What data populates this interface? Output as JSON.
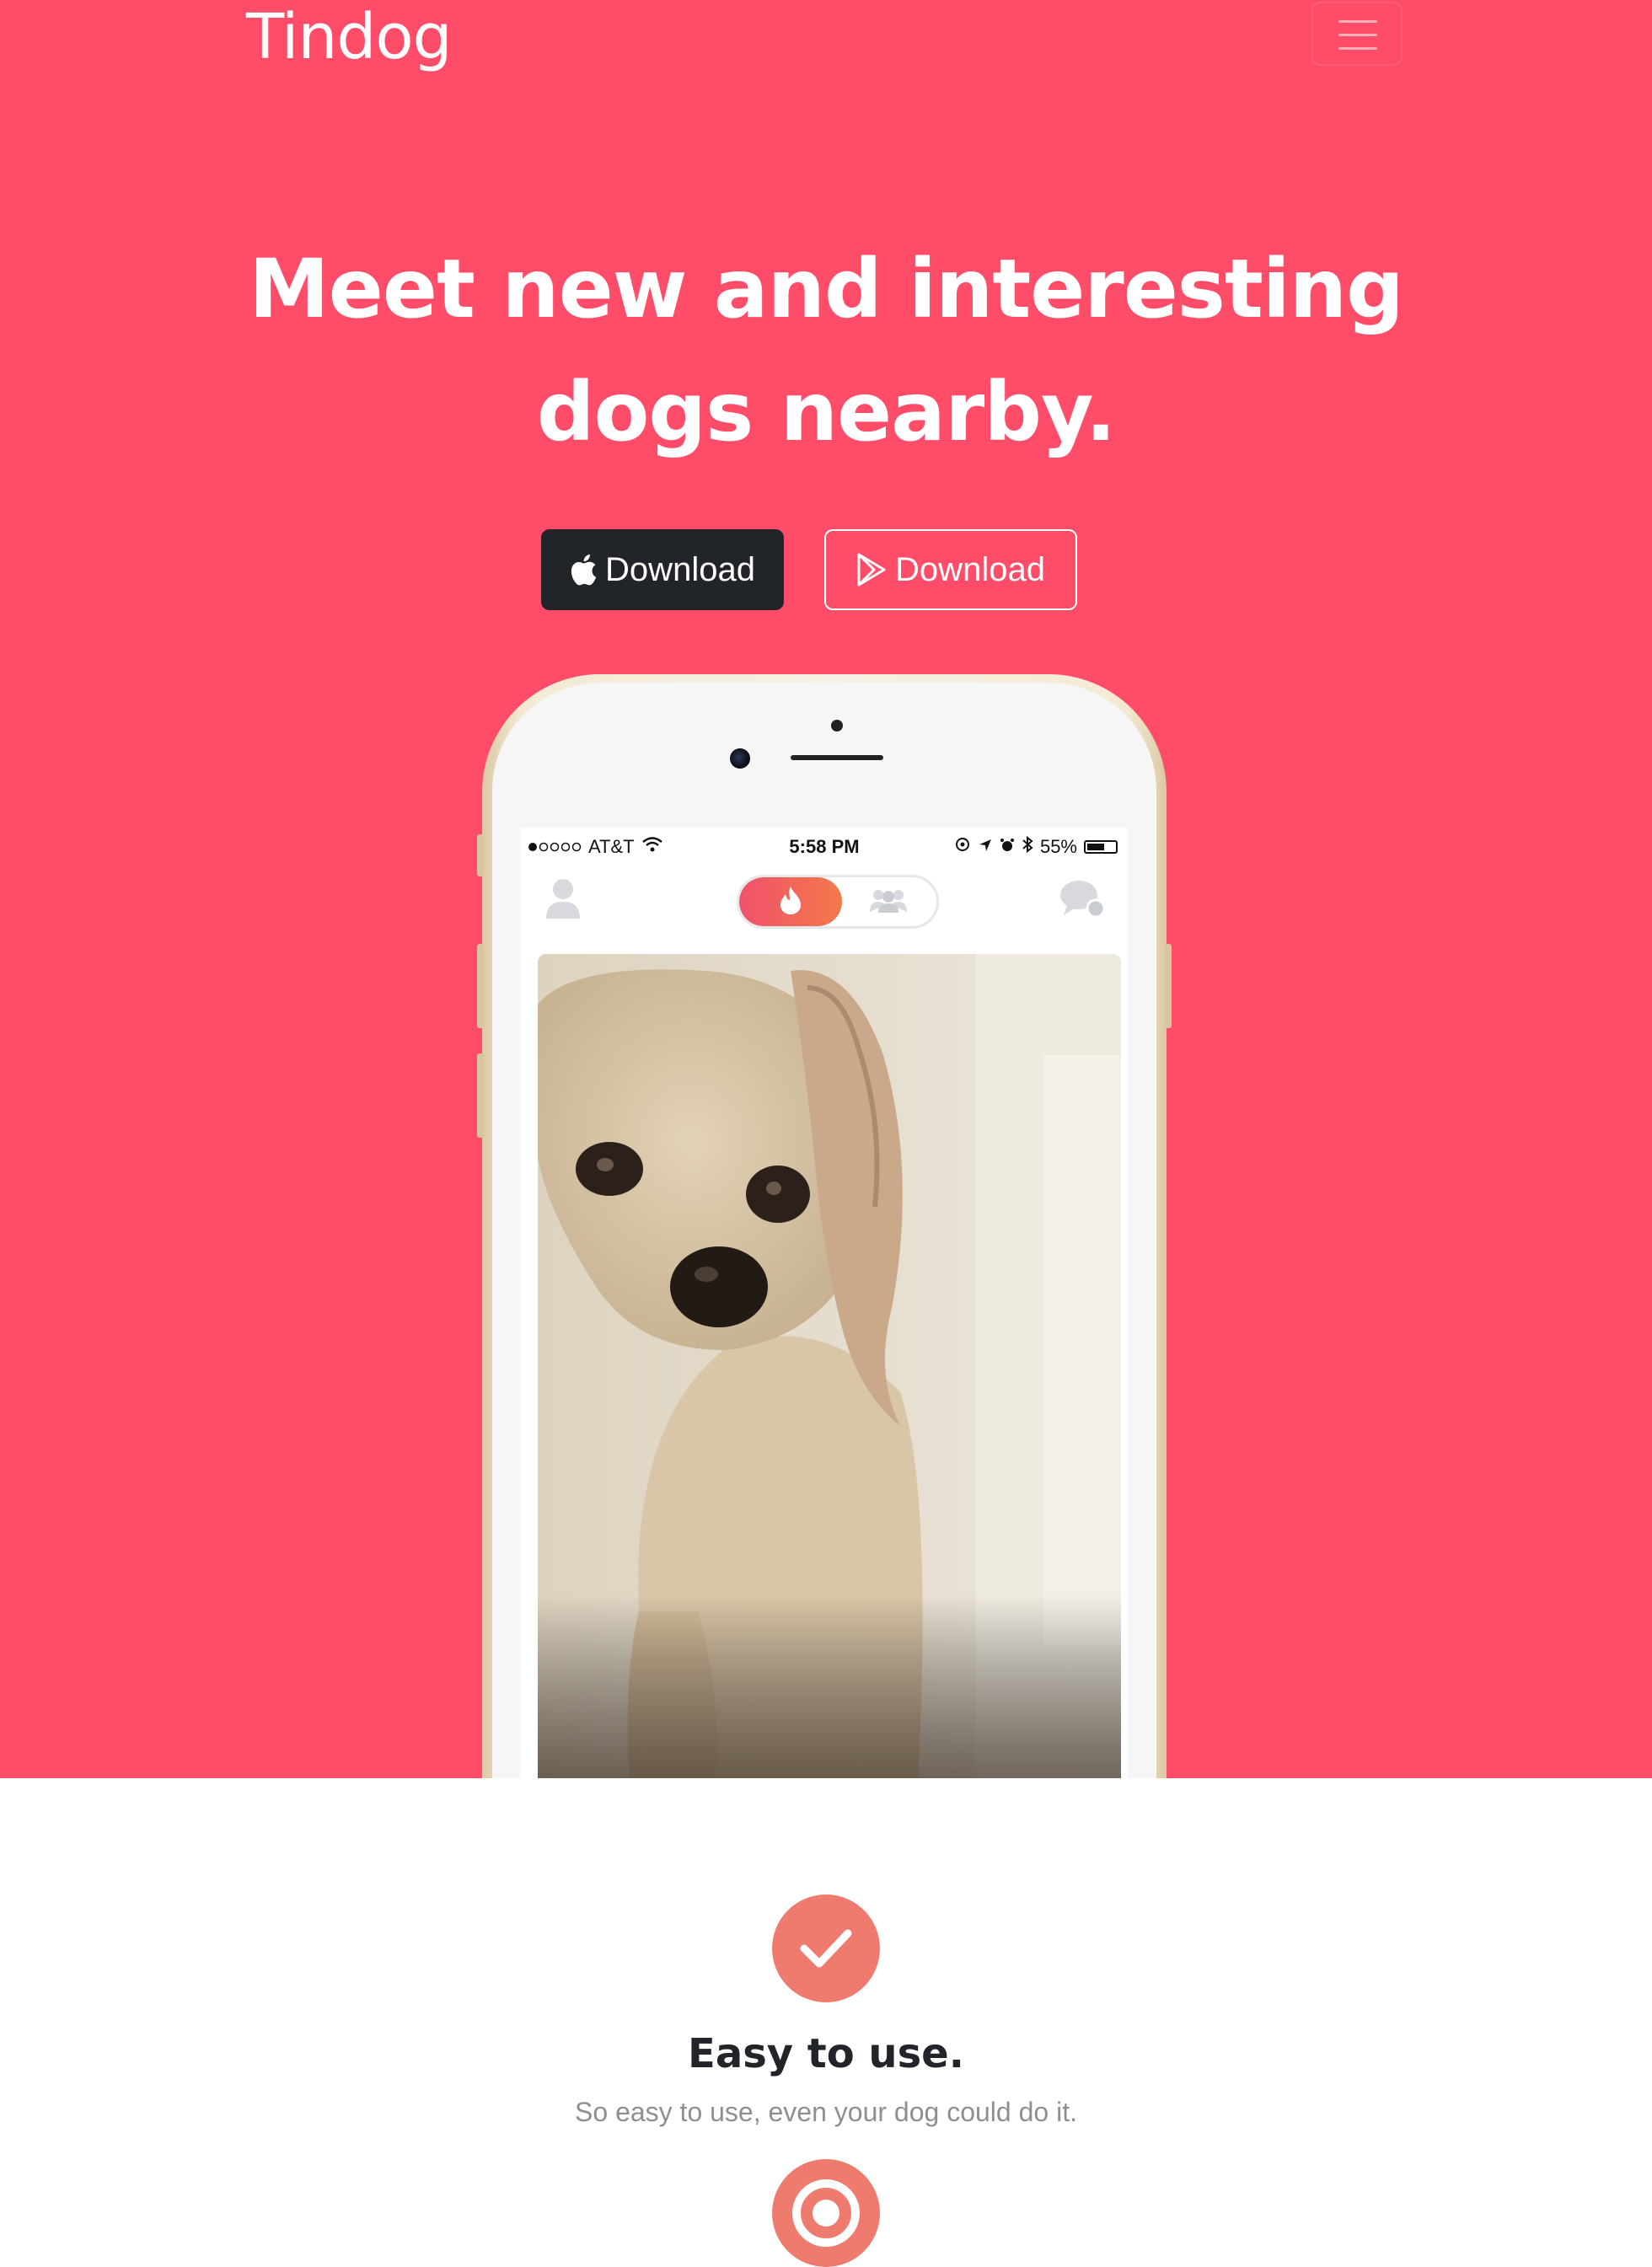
{
  "navbar": {
    "brand": "Tindog"
  },
  "hero": {
    "title_line1": "Meet new and interesting",
    "title_line2": "dogs nearby.",
    "buttons": [
      {
        "label": "Download",
        "icon": "apple-icon"
      },
      {
        "label": "Download",
        "icon": "google-play-icon"
      }
    ]
  },
  "phone": {
    "status_bar": {
      "carrier": "AT&T",
      "time": "5:58 PM",
      "battery": "55%"
    }
  },
  "features": [
    {
      "icon": "check-circle-icon",
      "title": "Easy to use.",
      "text": "So easy to use, even your dog could do it."
    }
  ],
  "colors": {
    "hero_bg": "#ff4c68",
    "dark_button": "#212529",
    "feature_icon": "#ef7b6f",
    "muted_text": "#8f8f8f"
  }
}
